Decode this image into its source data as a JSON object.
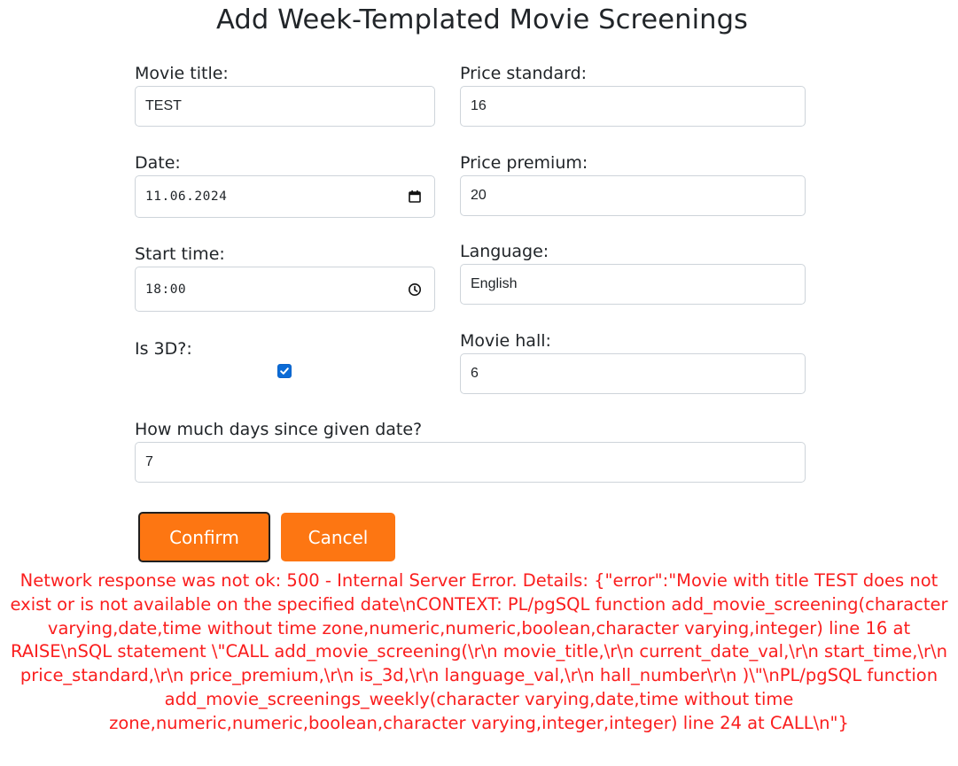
{
  "page": {
    "title": "Add Week-Templated Movie Screenings"
  },
  "form": {
    "movie_title": {
      "label": "Movie title:",
      "value": "TEST"
    },
    "price_standard": {
      "label": "Price standard:",
      "value": "16"
    },
    "date": {
      "label": "Date:",
      "value": "11.06.2024",
      "icon": "calendar-icon"
    },
    "price_premium": {
      "label": "Price premium:",
      "value": "20"
    },
    "start_time": {
      "label": "Start time:",
      "value": "18:00",
      "icon": "clock-icon"
    },
    "language": {
      "label": "Language:",
      "value": "English"
    },
    "is_3d": {
      "label": "Is 3D?:",
      "checked": true
    },
    "movie_hall": {
      "label": "Movie hall:",
      "value": "6"
    },
    "days": {
      "label": "How much days since given date?",
      "value": "7"
    }
  },
  "buttons": {
    "confirm": "Confirm",
    "cancel": "Cancel"
  },
  "error": {
    "message": "Network response was not ok: 500 - Internal Server Error. Details: {\"error\":\"Movie with title TEST does not exist or is not available on the specified date\\nCONTEXT: PL/pgSQL function add_movie_screening(character varying,date,time without time zone,numeric,numeric,boolean,character varying,integer) line 16 at RAISE\\nSQL statement \\\"CALL add_movie_screening(\\r\\n movie_title,\\r\\n current_date_val,\\r\\n start_time,\\r\\n price_standard,\\r\\n price_premium,\\r\\n is_3d,\\r\\n language_val,\\r\\n hall_number\\r\\n )\\\"\\nPL/pgSQL function add_movie_screenings_weekly(character varying,date,time without time zone,numeric,numeric,boolean,character varying,integer,integer) line 24 at CALL\\n\"}"
  },
  "colors": {
    "accent": "#fd7612",
    "error": "#fa1e1e",
    "checkbox": "#0b6bd6"
  }
}
